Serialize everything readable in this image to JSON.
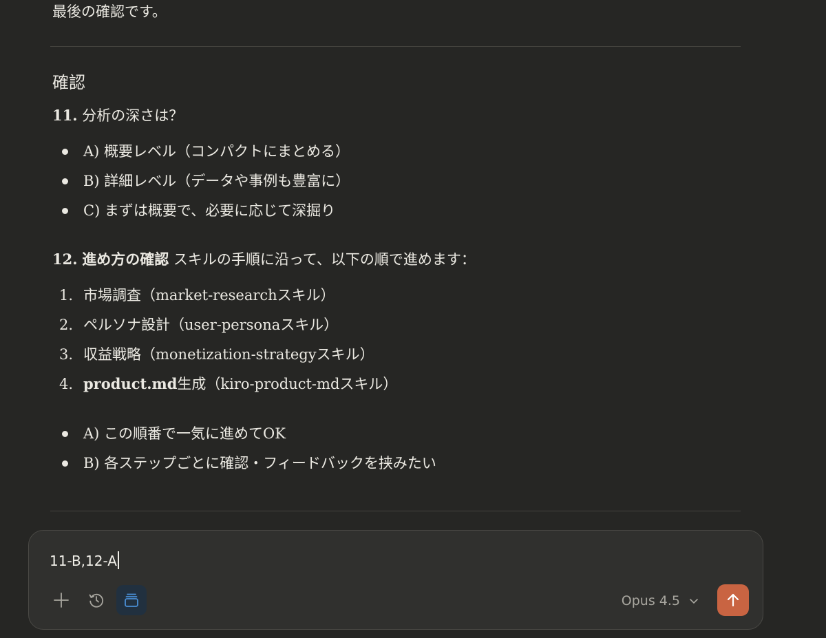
{
  "message": {
    "intro": "最後の確認です。",
    "heading": "確認",
    "q11": {
      "label": "11.",
      "title": "分析の深さは？",
      "options": [
        "A) 概要レベル（コンパクトにまとめる）",
        "B) 詳細レベル（データや事例も豊富に）",
        "C) まずは概要で、必要に応じて深掘り"
      ]
    },
    "q12": {
      "label": "12.",
      "title": "進め方の確認",
      "description": "スキルの手順に沿って、以下の順で進めます：",
      "steps": [
        {
          "num": "1.",
          "bold": "",
          "text": "市場調査（market-researchスキル）"
        },
        {
          "num": "2.",
          "bold": "",
          "text": "ペルソナ設計（user-personaスキル）"
        },
        {
          "num": "3.",
          "bold": "",
          "text": "収益戦略（monetization-strategyスキル）"
        },
        {
          "num": "4.",
          "bold": "product.md",
          "text": "生成（kiro-product-mdスキル）"
        }
      ],
      "options": [
        "A) この順番で一気に進めてOK",
        "B) 各ステップごとに確認・フィードバックを挟みたい"
      ]
    }
  },
  "composer": {
    "input_value": "11-B,12-A",
    "model_label": "Opus 4.5",
    "icons": {
      "add": "plus-icon",
      "history": "clock-icon",
      "project": "stack-icon",
      "model_dropdown": "chevron-down-icon",
      "send": "arrow-up-icon"
    },
    "colors": {
      "send_button": "#c96442",
      "active_tool": "#4a8fd6",
      "background": "#262624"
    }
  }
}
